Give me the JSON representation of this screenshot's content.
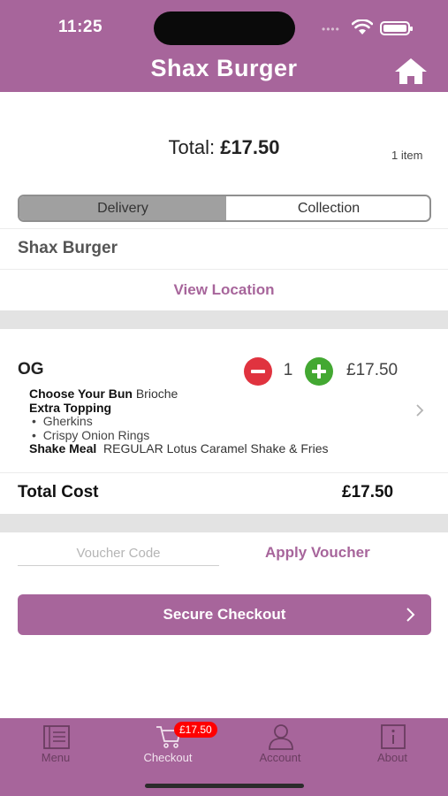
{
  "status_bar": {
    "time": "11:25"
  },
  "header": {
    "title": "Shax Burger",
    "home_icon": "home-icon"
  },
  "basket": {
    "total_label": "Total:",
    "total_amount": "£17.50",
    "item_count": "1 item"
  },
  "fulfilment": {
    "options": [
      "Delivery",
      "Collection"
    ],
    "selected": "Delivery"
  },
  "store": {
    "name": "Shax Burger",
    "view_location": "View Location"
  },
  "order_items": [
    {
      "name": "OG",
      "quantity": "1",
      "price": "£17.50",
      "bun_label": "Choose Your Bun",
      "bun_value": "Brioche",
      "topping_label": "Extra Topping",
      "toppings": [
        "Gherkins",
        "Crispy Onion Rings"
      ],
      "meal_label": "Shake Meal",
      "meal_value": "REGULAR Lotus Caramel Shake & Fries"
    }
  ],
  "summary": {
    "total_cost_label": "Total Cost",
    "total_cost_value": "£17.50"
  },
  "voucher": {
    "placeholder": "Voucher Code",
    "apply_label": "Apply Voucher"
  },
  "checkout": {
    "label": "Secure Checkout"
  },
  "tabbar": {
    "tabs": [
      {
        "label": "Menu",
        "icon": "menu-book-icon"
      },
      {
        "label": "Checkout",
        "icon": "cart-icon"
      },
      {
        "label": "Account",
        "icon": "person-icon"
      },
      {
        "label": "About",
        "icon": "info-icon"
      }
    ],
    "checkout_badge": "£17.50"
  },
  "colors": {
    "brand": "#a7659b",
    "minus": "#e0333f",
    "plus": "#43a832",
    "badge": "#ff0000"
  }
}
